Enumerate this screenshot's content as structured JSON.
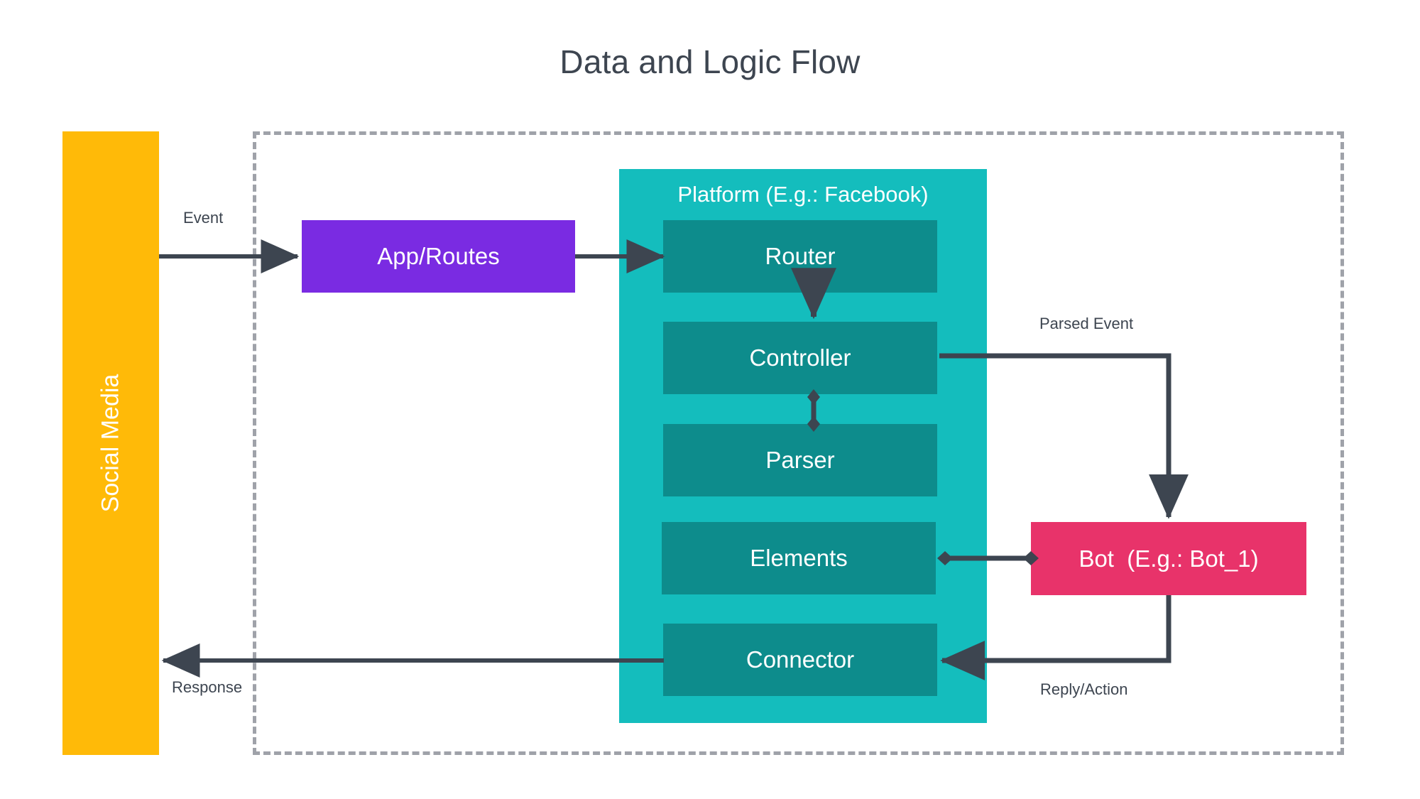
{
  "title": "Data and Logic Flow",
  "external": {
    "social_media_label": "Social Media"
  },
  "boundary": {
    "style": "dashed",
    "color": "#9fa2a9"
  },
  "nodes": {
    "app_routes": "App/Routes",
    "platform_title": "Platform (E.g.: Facebook)",
    "router": "Router",
    "controller": "Controller",
    "parser": "Parser",
    "elements": "Elements",
    "connector": "Connector",
    "bot": "Bot  (E.g.: Bot_1)"
  },
  "edges": {
    "event": "Event",
    "response": "Response",
    "parsed_event": "Parsed Event",
    "reply_action": "Reply/Action"
  },
  "colors": {
    "title_text": "#3d4550",
    "social_media": "#FFBA08",
    "app_routes": "#7A2BE2",
    "platform": "#14BDBD",
    "platform_inner": "#0D8C8C",
    "bot": "#E8336A",
    "connector_line": "#3d4550",
    "boundary_dash": "#9fa2a9",
    "background": "#FFFFFF"
  },
  "chart_data": {
    "type": "diagram",
    "title": "Data and Logic Flow",
    "nodes": [
      {
        "id": "social_media",
        "label": "Social Media",
        "shape": "vertical-bar",
        "color": "#FFBA08"
      },
      {
        "id": "app_routes",
        "label": "App/Routes",
        "shape": "rect",
        "color": "#7A2BE2"
      },
      {
        "id": "platform",
        "label": "Platform (E.g.: Facebook)",
        "shape": "container",
        "color": "#14BDBD"
      },
      {
        "id": "router",
        "label": "Router",
        "shape": "rect",
        "color": "#0D8C8C",
        "parent": "platform"
      },
      {
        "id": "controller",
        "label": "Controller",
        "shape": "rect",
        "color": "#0D8C8C",
        "parent": "platform"
      },
      {
        "id": "parser",
        "label": "Parser",
        "shape": "rect",
        "color": "#0D8C8C",
        "parent": "platform"
      },
      {
        "id": "elements",
        "label": "Elements",
        "shape": "rect",
        "color": "#0D8C8C",
        "parent": "platform"
      },
      {
        "id": "connector",
        "label": "Connector",
        "shape": "rect",
        "color": "#0D8C8C",
        "parent": "platform"
      },
      {
        "id": "bot",
        "label": "Bot  (E.g.: Bot_1)",
        "shape": "rect",
        "color": "#E8336A"
      }
    ],
    "edges": [
      {
        "from": "social_media",
        "to": "app_routes",
        "label": "Event",
        "arrow": "single"
      },
      {
        "from": "app_routes",
        "to": "router",
        "label": "",
        "arrow": "single"
      },
      {
        "from": "router",
        "to": "controller",
        "label": "",
        "arrow": "single"
      },
      {
        "from": "controller",
        "to": "parser",
        "label": "",
        "arrow": "diamond-both"
      },
      {
        "from": "controller",
        "to": "bot",
        "label": "Parsed Event",
        "arrow": "single"
      },
      {
        "from": "elements",
        "to": "bot",
        "label": "",
        "arrow": "diamond-both"
      },
      {
        "from": "bot",
        "to": "connector",
        "label": "Reply/Action",
        "arrow": "single"
      },
      {
        "from": "connector",
        "to": "social_media",
        "label": "Response",
        "arrow": "single"
      }
    ]
  }
}
